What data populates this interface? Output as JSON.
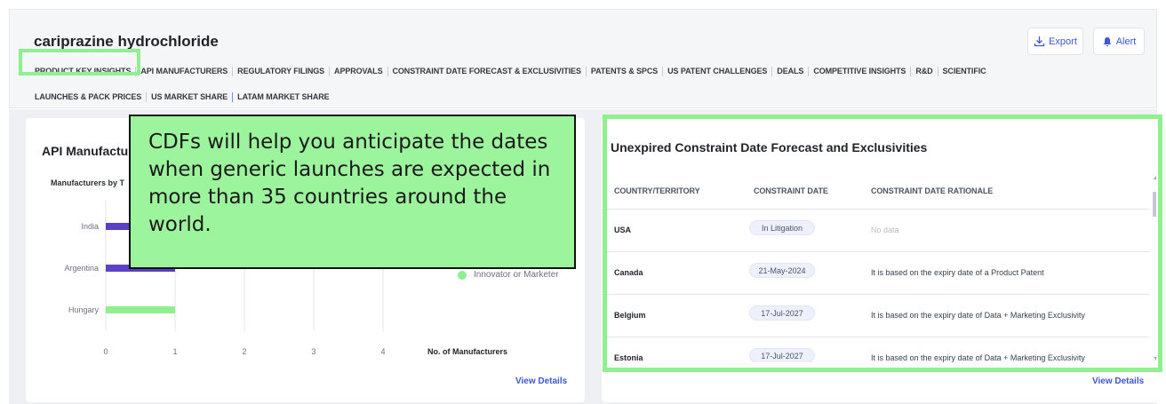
{
  "header": {
    "title": "cariprazine hydrochloride",
    "export_label": "Export",
    "alert_label": "Alert",
    "tabs_row1": [
      "PRODUCT KEY INSIGHTS",
      "API MANUFACTURERS",
      "REGULATORY FILINGS",
      "APPROVALS",
      "CONSTRAINT DATE FORECAST & EXCLUSIVITIES",
      "PATENTS & SPCS",
      "US PATENT CHALLENGES",
      "DEALS",
      "COMPETITIVE INSIGHTS",
      "R&D",
      "SCIENTIFIC"
    ],
    "tabs_row2": [
      "LAUNCHES & PACK PRICES",
      "US MARKET SHARE",
      "LATAM MARKET SHARE"
    ],
    "active_tab": "PRODUCT KEY INSIGHTS",
    "accent_color": "#3d57d6",
    "highlight_color": "#8ff08f"
  },
  "left_panel": {
    "title_visible": "API Manufactu",
    "chart_subtitle_visible": "Manufacturers by T",
    "view_details": "View Details"
  },
  "chart_data": {
    "type": "bar",
    "orientation": "horizontal",
    "categories": [
      "India",
      "Argentina",
      "Hungary"
    ],
    "series": [
      {
        "values": [
          1,
          1,
          0
        ],
        "color": "#5b3fc4"
      },
      {
        "name": "Innovator or Marketer",
        "values": [
          0,
          0,
          1
        ],
        "color": "#8ef08e"
      }
    ],
    "x_ticks": [
      "0",
      "1",
      "2",
      "3",
      "4"
    ],
    "xlabel": "No. of Manufacturers",
    "xlim": [
      0,
      4
    ],
    "grid": true,
    "legend_position": "right"
  },
  "right_panel": {
    "title": "Unexpired Constraint Date Forecast and Exclusivities",
    "columns": [
      "COUNTRY/TERRITORY",
      "CONSTRAINT DATE",
      "CONSTRAINT DATE RATIONALE"
    ],
    "rows": [
      {
        "country": "USA",
        "date": "In Litigation",
        "rationale": "No data"
      },
      {
        "country": "Canada",
        "date": "21-May-2024",
        "rationale": "It is based on the expiry date of a Product Patent"
      },
      {
        "country": "Belgium",
        "date": "17-Jul-2027",
        "rationale": "It is based on the expiry date of Data + Marketing Exclusivity"
      },
      {
        "country": "Estonia",
        "date": "17-Jul-2027",
        "rationale": "It is based on the expiry date of Data + Marketing Exclusivity"
      }
    ],
    "view_details": "View Details"
  },
  "callout": {
    "text": "CDFs will help you anticipate the dates when generic launches are expected in more than 35 countries around the world."
  }
}
